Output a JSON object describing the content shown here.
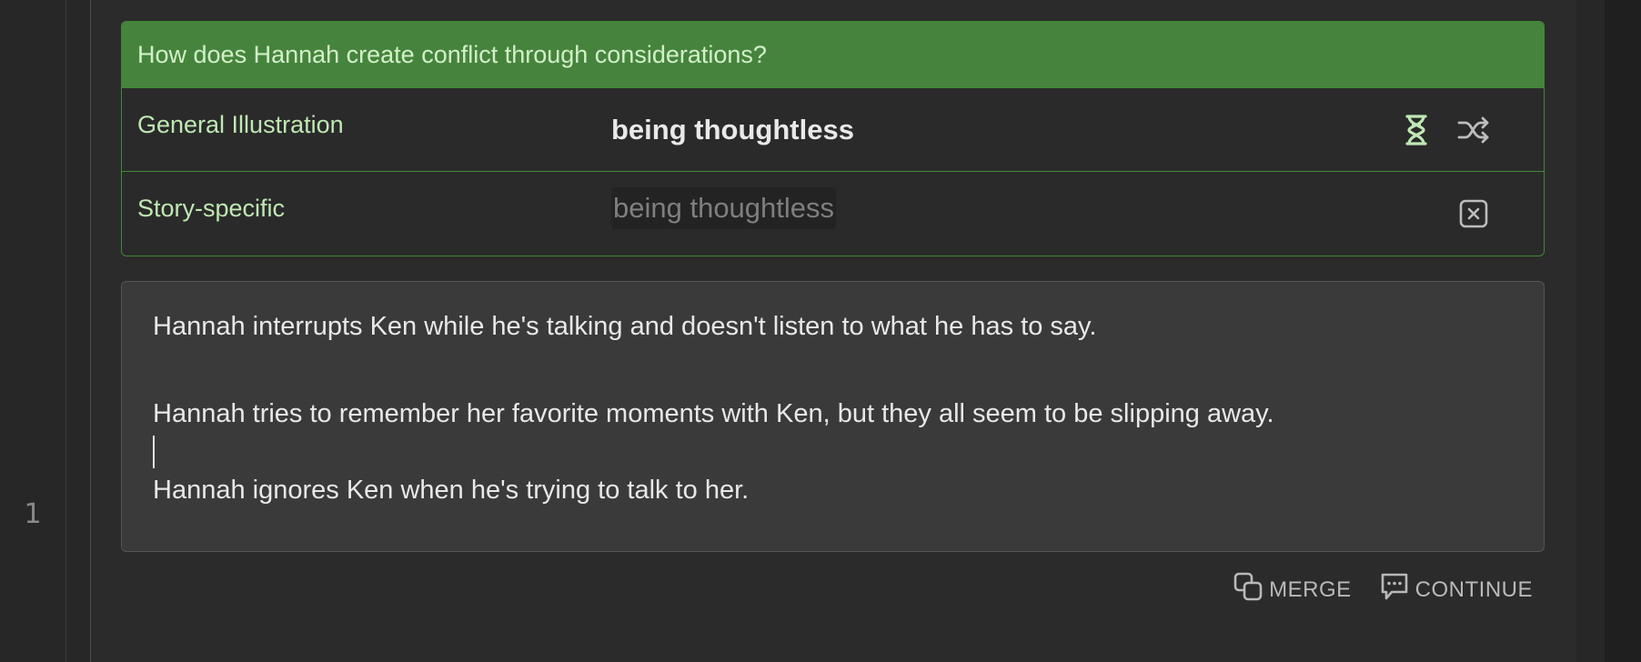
{
  "gutter": {
    "line_number": "1"
  },
  "card": {
    "question": "How does Hannah create conflict through considerations?",
    "rows": [
      {
        "label": "General Illustration",
        "value": "being thoughtless",
        "icons": [
          "hourglass-icon",
          "shuffle-icon"
        ]
      },
      {
        "label": "Story-specific",
        "value": "being thoughtless",
        "icons": [
          "close-box-icon"
        ]
      }
    ]
  },
  "textbox": {
    "lines": [
      "Hannah interrupts Ken while he's talking and doesn't listen to what he has to say.",
      "Hannah tries to remember her favorite moments with Ken, but they all seem to be slipping away.",
      "Hannah ignores Ken when he's trying to talk to her."
    ]
  },
  "actions": {
    "merge_label": "MERGE",
    "continue_label": "CONTINUE"
  },
  "colors": {
    "accent_green": "#46843d",
    "border_green": "#3f8a35",
    "label_green": "#bfe8b3",
    "background": "#272727"
  }
}
